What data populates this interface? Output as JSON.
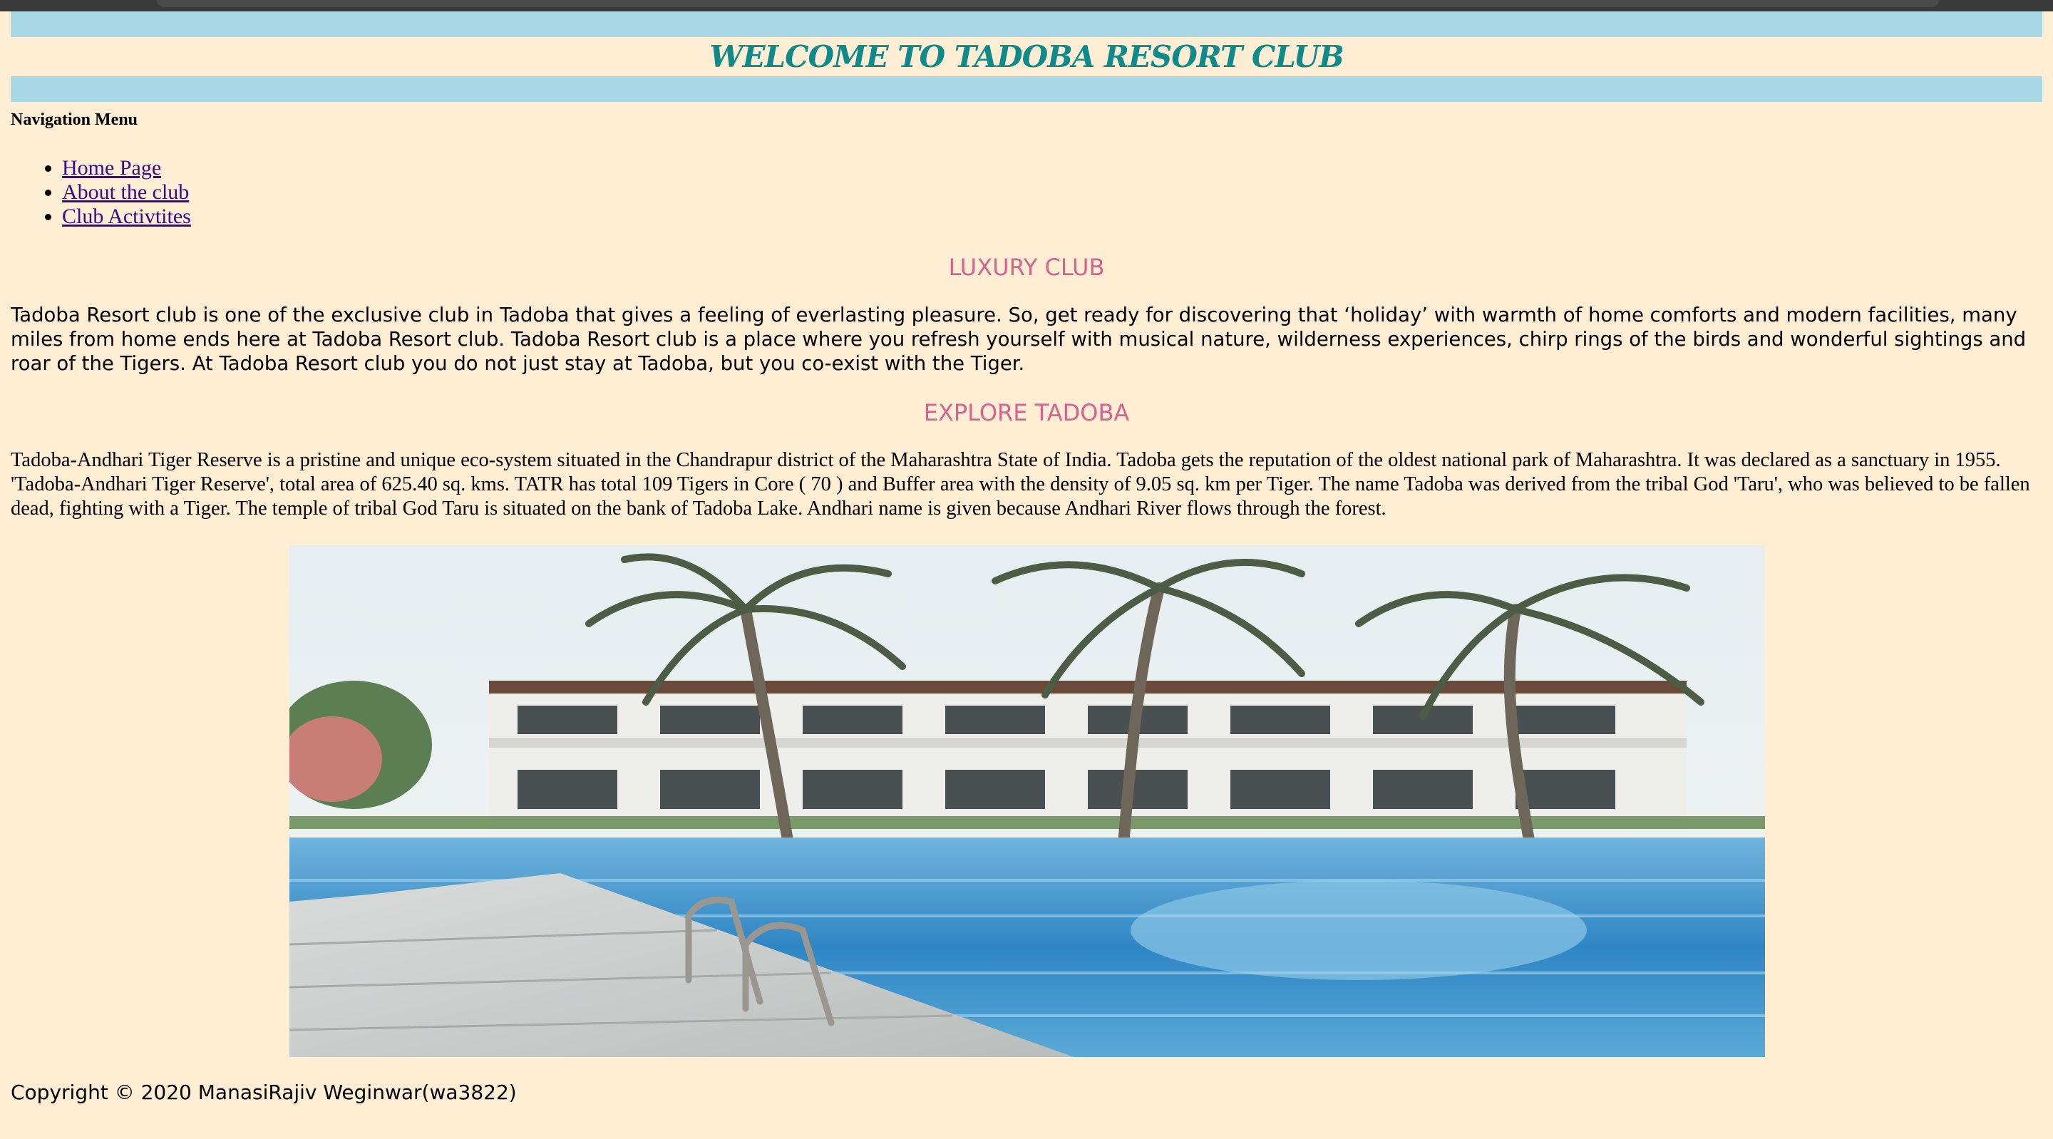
{
  "header": {
    "title": "WELCOME TO TADOBA RESORT CLUB"
  },
  "nav": {
    "heading": "Navigation Menu",
    "items": [
      {
        "label": "Home Page"
      },
      {
        "label": "About the club"
      },
      {
        "label": "Club Activtites"
      }
    ]
  },
  "sections": [
    {
      "heading": "LUXURY CLUB",
      "text": "Tadoba Resort club is one of the exclusive club in Tadoba that gives a feeling of everlasting pleasure. So, get ready for discovering that ‘holiday’ with warmth of home comforts and modern facilities, many miles from home ends here at Tadoba Resort club. Tadoba Resort club is a place where you refresh yourself with musical nature, wilderness experiences, chirp rings of the birds and wonderful sightings and roar of the Tigers. At Tadoba Resort club you do not just stay at Tadoba, but you co-exist with the Tiger."
    },
    {
      "heading": "EXPLORE TADOBA",
      "text": "Tadoba-Andhari Tiger Reserve is a pristine and unique eco-system situated in the Chandrapur district of the Maharashtra State of India. Tadoba gets the reputation of the oldest national park of Maharashtra. It was declared as a sanctuary in 1955. 'Tadoba-Andhari Tiger Reserve', total area of 625.40 sq. kms. TATR has total 109 Tigers in Core ( 70 ) and Buffer area with the density of 9.05 sq. km per Tiger. The name Tadoba was derived from the tribal God 'Taru', who was believed to be fallen dead, fighting with a Tiger. The temple of tribal God Taru is situated on the bank of Tadoba Lake. Andhari name is given because Andhari River flows through the forest."
    }
  ],
  "hero": {
    "icon": "resort-pool-photo"
  },
  "footer": {
    "copyright": "Copyright © 2020 ManasiRajiv Weginwar(wa3822)"
  },
  "colors": {
    "background": "#ffeed3",
    "title_bar": "#a9d8e6",
    "title_text": "#0f8a8a",
    "section_heading": "#d6628e",
    "link": "#3b0a8c"
  }
}
